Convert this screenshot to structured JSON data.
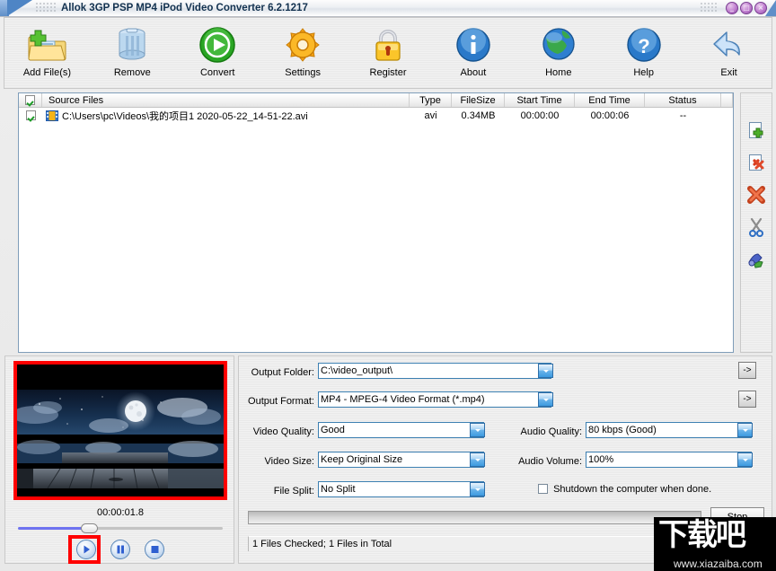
{
  "window": {
    "title": "Allok 3GP PSP MP4 iPod Video Converter 6.2.1217",
    "minimize_label": "_",
    "maximize_label": "□",
    "close_label": "×"
  },
  "toolbar": {
    "buttons": [
      {
        "label": "Add File(s)",
        "icon": "add-folder-icon",
        "accel": "A"
      },
      {
        "label": "Remove",
        "icon": "trash-bin-icon",
        "accel": "R"
      },
      {
        "label": "Convert",
        "icon": "green-play-icon",
        "accel": "C"
      },
      {
        "label": "Settings",
        "icon": "orange-gear-icon",
        "accel": "S"
      },
      {
        "label": "Register",
        "icon": "yellow-lock-icon",
        "accel": "R"
      },
      {
        "label": "About",
        "icon": "blue-info-icon",
        "accel": "b"
      },
      {
        "label": "Home",
        "icon": "globe-icon",
        "accel": "o"
      },
      {
        "label": "Help",
        "icon": "blue-question-icon",
        "accel": "H"
      },
      {
        "label": "Exit",
        "icon": "blue-back-arrow-icon",
        "accel": "x"
      }
    ]
  },
  "filelist": {
    "columns": [
      "",
      "Source Files",
      "Type",
      "FileSize",
      "Start Time",
      "End Time",
      "Status",
      ""
    ],
    "header_checked": true,
    "rows": [
      {
        "checked": true,
        "source": "C:\\Users\\pc\\Videos\\我的项目1 2020-05-22_14-51-22.avi",
        "type": "avi",
        "filesize": "0.34MB",
        "start_time": "00:00:00",
        "end_time": "00:00:06",
        "status": "--"
      }
    ]
  },
  "sidetools": [
    {
      "icon": "add-file-icon"
    },
    {
      "icon": "remove-file-icon"
    },
    {
      "icon": "delete-all-icon"
    },
    {
      "icon": "cut-scissors-icon"
    },
    {
      "icon": "merge-tools-icon"
    }
  ],
  "preview": {
    "time": "00:00:01.8",
    "play_label": "play-button",
    "pause_label": "pause-button",
    "stop_label": "stop-button",
    "seek_percent": 34
  },
  "settings": {
    "output_folder_label": "Output Folder:",
    "output_folder_value": "C:\\video_output\\",
    "output_format_label": "Output Format:",
    "output_format_value": "MP4 - MPEG-4 Video Format (*.mp4)",
    "browse_label": "->",
    "video_quality_label": "Video Quality:",
    "video_quality_value": "Good",
    "video_size_label": "Video Size:",
    "video_size_value": "Keep Original Size",
    "file_split_label": "File Split:",
    "file_split_value": "No Split",
    "audio_quality_label": "Audio Quality:",
    "audio_quality_value": "80  kbps (Good)",
    "audio_volume_label": "Audio Volume:",
    "audio_volume_value": "100%",
    "shutdown_label": "Shutdown the computer when done.",
    "shutdown_checked": false,
    "stop_label": "Stop",
    "status": "1 Files Checked; 1 Files in Total"
  },
  "watermark": {
    "text": "下载吧",
    "url": "www.xiazaiba.com"
  },
  "colors": {
    "highlight": "#ff0000",
    "title_text": "#12314f",
    "field_border": "#3c7fb1"
  }
}
